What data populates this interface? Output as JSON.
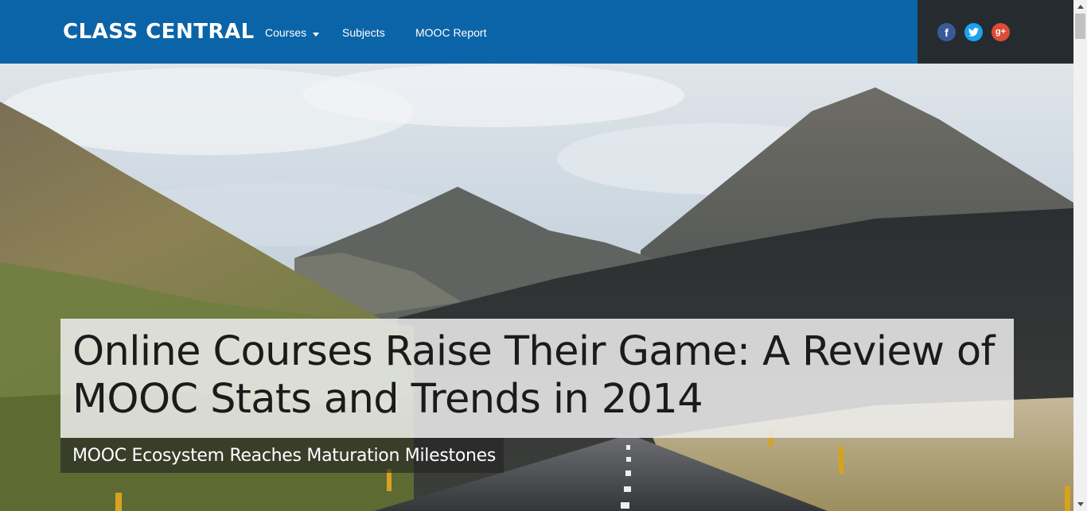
{
  "header": {
    "logo": "CLASS CENTRAL",
    "nav": [
      {
        "label": "Courses",
        "has_dropdown": true
      },
      {
        "label": "Subjects"
      },
      {
        "label": "MOOC Report"
      }
    ],
    "social": [
      {
        "name": "facebook-icon",
        "glyph": "f",
        "color": "#3b5998"
      },
      {
        "name": "twitter-icon",
        "glyph": "t",
        "color": "#1da1f2"
      },
      {
        "name": "google-plus-icon",
        "glyph": "g+",
        "color": "#dd4b39"
      }
    ]
  },
  "hero": {
    "title": "Online Courses Raise Their Game: A Review of MOOC Stats and Trends in 2014",
    "subtitle": "MOOC Ecosystem Reaches Maturation Milestones"
  },
  "colors": {
    "header_bg": "#0c64a8",
    "social_bg": "#262b30"
  }
}
